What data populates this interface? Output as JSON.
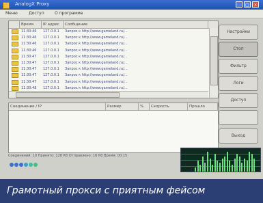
{
  "window": {
    "title": "AnalogX Proxy"
  },
  "menu": [
    "Меню",
    "Доступ",
    "О программе"
  ],
  "upper_list": {
    "columns": [
      "Время",
      "IP адрес",
      "Сообщение"
    ],
    "rows": [
      {
        "time": "11:30:46",
        "ip": "127.0.0.1",
        "msg": "Запрос к http://www.gameland.ru/..."
      },
      {
        "time": "11:30:46",
        "ip": "127.0.0.1",
        "msg": "Запрос к http://www.gameland.ru/..."
      },
      {
        "time": "11:30:46",
        "ip": "127.0.0.1",
        "msg": "Запрос к http://www.gameland.ru/..."
      },
      {
        "time": "11:30:46",
        "ip": "127.0.0.1",
        "msg": "Запрос к http://www.gameland.ru/..."
      },
      {
        "time": "11:30:47",
        "ip": "127.0.0.1",
        "msg": "Запрос к http://www.gameland.ru/..."
      },
      {
        "time": "11:30:47",
        "ip": "127.0.0.1",
        "msg": "Запрос к http://www.gameland.ru/..."
      },
      {
        "time": "11:30:47",
        "ip": "127.0.0.1",
        "msg": "Запрос к http://www.gameland.ru/..."
      },
      {
        "time": "11:30:47",
        "ip": "127.0.0.1",
        "msg": "Запрос к http://www.gameland.ru/..."
      },
      {
        "time": "11:30:47",
        "ip": "127.0.0.1",
        "msg": "Запрос к http://www.gameland.ru/..."
      },
      {
        "time": "11:30:48",
        "ip": "127.0.0.1",
        "msg": "Запрос к http://www.gameland.ru/..."
      }
    ]
  },
  "lower_list": {
    "columns": [
      "Соединение / IP",
      "Размер",
      "%",
      "Скорость",
      "Прошло"
    ]
  },
  "buttons": [
    "Настройки",
    "Стоп",
    "Фильтр",
    "Логи",
    "Доступ",
    "",
    "Выход"
  ],
  "status_text": "Соединений: 10   Принято: 128 Кб   Отправлено: 16 Кб   Время: 00:15",
  "status_dot_colors": [
    "#3a6fd1",
    "#3a6fd1",
    "#3a6fd1",
    "#3aa0d1",
    "#3ac0a0",
    "#40c080"
  ],
  "traffic_levels": [
    0.2,
    0.5,
    0.3,
    0.7,
    0.4,
    0.9,
    0.6,
    0.3,
    0.8,
    0.5,
    0.4,
    0.6,
    0.7,
    0.9,
    0.5,
    0.3,
    0.6,
    0.8,
    0.7,
    0.4,
    0.6,
    0.5,
    0.9,
    0.8,
    0.6
  ],
  "caption": "Грамотный прокси с приятным фейсом"
}
